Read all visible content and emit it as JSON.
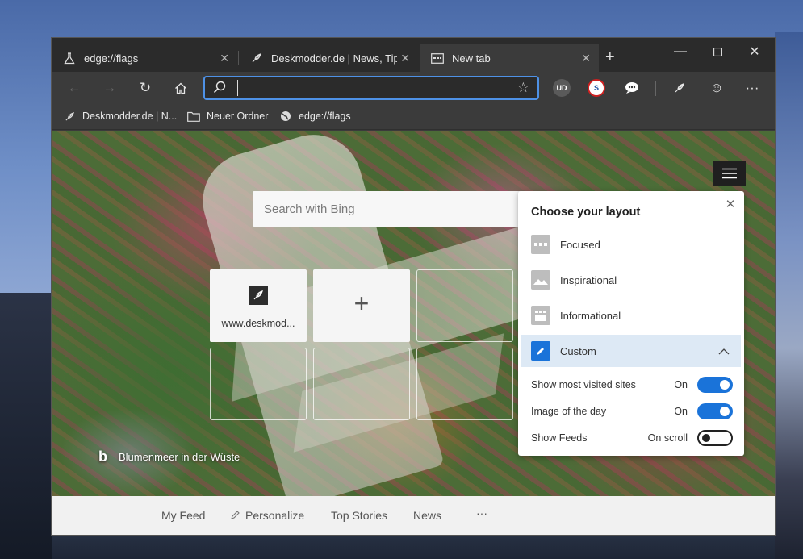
{
  "tabs": [
    {
      "label": "edge://flags",
      "icon": "flask-icon"
    },
    {
      "label": "Deskmodder.de | News, Tipps",
      "icon": "feather-icon"
    },
    {
      "label": "New tab",
      "icon": "newtab-icon"
    }
  ],
  "toolbar": {
    "address_value": "",
    "ext_badges": [
      "UD",
      "S"
    ]
  },
  "favorites": [
    {
      "label": "Deskmodder.de | N...",
      "icon": "feather-icon"
    },
    {
      "label": "Neuer Ordner",
      "icon": "folder-icon"
    },
    {
      "label": "edge://flags",
      "icon": "globe-icon"
    }
  ],
  "newtab": {
    "search_placeholder": "Search with Bing",
    "tile_label": "www.deskmod...",
    "photo_credit": "Blumenmeer in der Wüste",
    "bing_mark": "b"
  },
  "layout_panel": {
    "title": "Choose your layout",
    "options": [
      "Focused",
      "Inspirational",
      "Informational",
      "Custom"
    ],
    "settings": [
      {
        "label": "Show most visited sites",
        "value": "On",
        "state": "on"
      },
      {
        "label": "Image of the day",
        "value": "On",
        "state": "on"
      },
      {
        "label": "Show Feeds",
        "value": "On scroll",
        "state": "off"
      }
    ]
  },
  "feed": {
    "items": [
      "My Feed",
      "Personalize",
      "Top Stories",
      "News"
    ],
    "more": "···"
  },
  "colors": {
    "accent": "#1a73d9",
    "focus_ring": "#4e91e6"
  }
}
